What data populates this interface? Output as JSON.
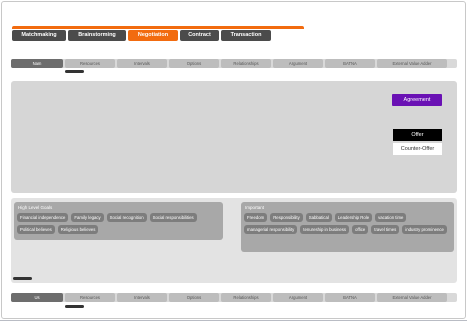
{
  "stages": [
    {
      "label": "Matchmaking",
      "active": false
    },
    {
      "label": "Brainstorming",
      "active": false
    },
    {
      "label": "Negotiation",
      "active": true
    },
    {
      "label": "Contract",
      "active": false
    },
    {
      "label": "Transaction",
      "active": false
    }
  ],
  "top_strip": {
    "first": "Nam",
    "issues": [
      "Resources",
      "Intervals",
      "Options",
      "Relationships",
      "Argument",
      "BATNA",
      "External Value Adder"
    ]
  },
  "bottom_strip": {
    "first": "Us",
    "issues": [
      "Resources",
      "Intervals",
      "Options",
      "Relationships",
      "Argument",
      "BATNA",
      "External Value Adder"
    ]
  },
  "buttons": {
    "agreement": "Agreement",
    "offer": "Offer",
    "counter_offer": "Counter-Offer"
  },
  "high_level_goals": {
    "title": "High Level Goals",
    "chips": [
      "Financial independence",
      "Family legacy",
      "Social recognition",
      "Social responsibilities",
      "Political believes",
      "Religious believes"
    ]
  },
  "important": {
    "title": "Important",
    "chips": [
      "Freedom",
      "Responsibility",
      "Sabbatical",
      "Leadership Role",
      "vacation time",
      "managerial responsibility",
      "tenureship in business",
      "office",
      "travel times",
      "industry prominence"
    ]
  },
  "colors": {
    "accent": "#f26b0f",
    "agreement": "#6a11b4"
  }
}
